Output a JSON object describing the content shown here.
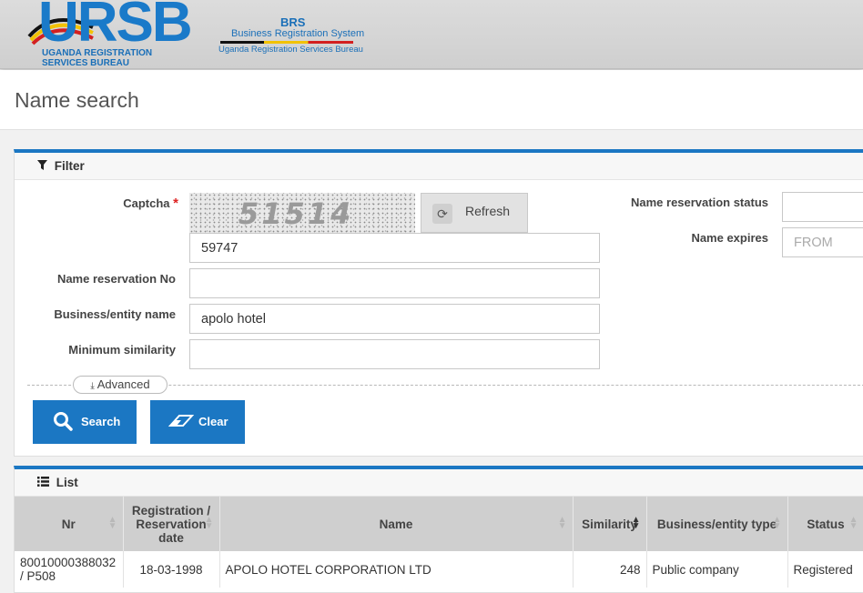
{
  "header": {
    "logo_text": "URSB",
    "logo_subtitle_line1": "UGANDA REGISTRATION",
    "logo_subtitle_line2": "SERVICES BUREAU",
    "brs_title": "BRS",
    "brs_subtitle": "Business Registration System",
    "brs_bureau": "Uganda Registration Services Bureau"
  },
  "page": {
    "title": "Name search"
  },
  "filter": {
    "heading": "Filter",
    "captcha_label": "Captcha",
    "captcha_required": "*",
    "captcha_image_text": "51514",
    "refresh_label": "Refresh",
    "captcha_value": "59747",
    "reservation_no_label": "Name reservation No",
    "reservation_no_value": "",
    "entity_name_label": "Business/entity name",
    "entity_name_value": "apolo hotel",
    "min_similarity_label": "Minimum similarity",
    "min_similarity_value": "",
    "reservation_status_label": "Name reservation status",
    "reservation_status_value": "",
    "name_expires_label": "Name expires",
    "name_expires_placeholder": "FROM",
    "advanced_label": "Advanced",
    "search_label": "Search",
    "clear_label": "Clear"
  },
  "list": {
    "heading": "List",
    "columns": [
      "Nr",
      "Registration / Reservation date",
      "Name",
      "Similarity",
      "Business/entity type",
      "Status"
    ],
    "rows": [
      {
        "nr": "80010000388032 / P508",
        "date": "18-03-1998",
        "name": "APOLO HOTEL CORPORATION LTD",
        "similarity": "248",
        "type": "Public company",
        "status": "Registered"
      }
    ]
  },
  "colors": {
    "accent": "#1b77c3",
    "required": "#dd2222",
    "header_bg": "#d6d6d6"
  },
  "icons": [
    "refresh-icon",
    "filter-icon",
    "list-icon",
    "search-icon",
    "eraser-icon",
    "download-icon"
  ]
}
